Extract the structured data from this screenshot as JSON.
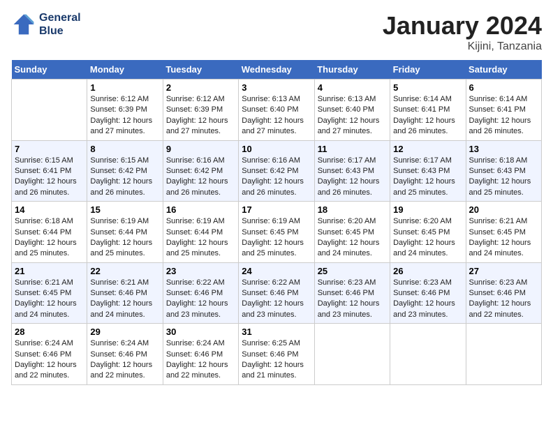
{
  "header": {
    "logo_line1": "General",
    "logo_line2": "Blue",
    "title": "January 2024",
    "subtitle": "Kijini, Tanzania"
  },
  "days_of_week": [
    "Sunday",
    "Monday",
    "Tuesday",
    "Wednesday",
    "Thursday",
    "Friday",
    "Saturday"
  ],
  "weeks": [
    [
      {
        "day": "",
        "sunrise": "",
        "sunset": "",
        "daylight": ""
      },
      {
        "day": "1",
        "sunrise": "Sunrise: 6:12 AM",
        "sunset": "Sunset: 6:39 PM",
        "daylight": "Daylight: 12 hours and 27 minutes."
      },
      {
        "day": "2",
        "sunrise": "Sunrise: 6:12 AM",
        "sunset": "Sunset: 6:39 PM",
        "daylight": "Daylight: 12 hours and 27 minutes."
      },
      {
        "day": "3",
        "sunrise": "Sunrise: 6:13 AM",
        "sunset": "Sunset: 6:40 PM",
        "daylight": "Daylight: 12 hours and 27 minutes."
      },
      {
        "day": "4",
        "sunrise": "Sunrise: 6:13 AM",
        "sunset": "Sunset: 6:40 PM",
        "daylight": "Daylight: 12 hours and 27 minutes."
      },
      {
        "day": "5",
        "sunrise": "Sunrise: 6:14 AM",
        "sunset": "Sunset: 6:41 PM",
        "daylight": "Daylight: 12 hours and 26 minutes."
      },
      {
        "day": "6",
        "sunrise": "Sunrise: 6:14 AM",
        "sunset": "Sunset: 6:41 PM",
        "daylight": "Daylight: 12 hours and 26 minutes."
      }
    ],
    [
      {
        "day": "7",
        "sunrise": "Sunrise: 6:15 AM",
        "sunset": "Sunset: 6:41 PM",
        "daylight": "Daylight: 12 hours and 26 minutes."
      },
      {
        "day": "8",
        "sunrise": "Sunrise: 6:15 AM",
        "sunset": "Sunset: 6:42 PM",
        "daylight": "Daylight: 12 hours and 26 minutes."
      },
      {
        "day": "9",
        "sunrise": "Sunrise: 6:16 AM",
        "sunset": "Sunset: 6:42 PM",
        "daylight": "Daylight: 12 hours and 26 minutes."
      },
      {
        "day": "10",
        "sunrise": "Sunrise: 6:16 AM",
        "sunset": "Sunset: 6:42 PM",
        "daylight": "Daylight: 12 hours and 26 minutes."
      },
      {
        "day": "11",
        "sunrise": "Sunrise: 6:17 AM",
        "sunset": "Sunset: 6:43 PM",
        "daylight": "Daylight: 12 hours and 26 minutes."
      },
      {
        "day": "12",
        "sunrise": "Sunrise: 6:17 AM",
        "sunset": "Sunset: 6:43 PM",
        "daylight": "Daylight: 12 hours and 25 minutes."
      },
      {
        "day": "13",
        "sunrise": "Sunrise: 6:18 AM",
        "sunset": "Sunset: 6:43 PM",
        "daylight": "Daylight: 12 hours and 25 minutes."
      }
    ],
    [
      {
        "day": "14",
        "sunrise": "Sunrise: 6:18 AM",
        "sunset": "Sunset: 6:44 PM",
        "daylight": "Daylight: 12 hours and 25 minutes."
      },
      {
        "day": "15",
        "sunrise": "Sunrise: 6:19 AM",
        "sunset": "Sunset: 6:44 PM",
        "daylight": "Daylight: 12 hours and 25 minutes."
      },
      {
        "day": "16",
        "sunrise": "Sunrise: 6:19 AM",
        "sunset": "Sunset: 6:44 PM",
        "daylight": "Daylight: 12 hours and 25 minutes."
      },
      {
        "day": "17",
        "sunrise": "Sunrise: 6:19 AM",
        "sunset": "Sunset: 6:45 PM",
        "daylight": "Daylight: 12 hours and 25 minutes."
      },
      {
        "day": "18",
        "sunrise": "Sunrise: 6:20 AM",
        "sunset": "Sunset: 6:45 PM",
        "daylight": "Daylight: 12 hours and 24 minutes."
      },
      {
        "day": "19",
        "sunrise": "Sunrise: 6:20 AM",
        "sunset": "Sunset: 6:45 PM",
        "daylight": "Daylight: 12 hours and 24 minutes."
      },
      {
        "day": "20",
        "sunrise": "Sunrise: 6:21 AM",
        "sunset": "Sunset: 6:45 PM",
        "daylight": "Daylight: 12 hours and 24 minutes."
      }
    ],
    [
      {
        "day": "21",
        "sunrise": "Sunrise: 6:21 AM",
        "sunset": "Sunset: 6:45 PM",
        "daylight": "Daylight: 12 hours and 24 minutes."
      },
      {
        "day": "22",
        "sunrise": "Sunrise: 6:21 AM",
        "sunset": "Sunset: 6:46 PM",
        "daylight": "Daylight: 12 hours and 24 minutes."
      },
      {
        "day": "23",
        "sunrise": "Sunrise: 6:22 AM",
        "sunset": "Sunset: 6:46 PM",
        "daylight": "Daylight: 12 hours and 23 minutes."
      },
      {
        "day": "24",
        "sunrise": "Sunrise: 6:22 AM",
        "sunset": "Sunset: 6:46 PM",
        "daylight": "Daylight: 12 hours and 23 minutes."
      },
      {
        "day": "25",
        "sunrise": "Sunrise: 6:23 AM",
        "sunset": "Sunset: 6:46 PM",
        "daylight": "Daylight: 12 hours and 23 minutes."
      },
      {
        "day": "26",
        "sunrise": "Sunrise: 6:23 AM",
        "sunset": "Sunset: 6:46 PM",
        "daylight": "Daylight: 12 hours and 23 minutes."
      },
      {
        "day": "27",
        "sunrise": "Sunrise: 6:23 AM",
        "sunset": "Sunset: 6:46 PM",
        "daylight": "Daylight: 12 hours and 22 minutes."
      }
    ],
    [
      {
        "day": "28",
        "sunrise": "Sunrise: 6:24 AM",
        "sunset": "Sunset: 6:46 PM",
        "daylight": "Daylight: 12 hours and 22 minutes."
      },
      {
        "day": "29",
        "sunrise": "Sunrise: 6:24 AM",
        "sunset": "Sunset: 6:46 PM",
        "daylight": "Daylight: 12 hours and 22 minutes."
      },
      {
        "day": "30",
        "sunrise": "Sunrise: 6:24 AM",
        "sunset": "Sunset: 6:46 PM",
        "daylight": "Daylight: 12 hours and 22 minutes."
      },
      {
        "day": "31",
        "sunrise": "Sunrise: 6:25 AM",
        "sunset": "Sunset: 6:46 PM",
        "daylight": "Daylight: 12 hours and 21 minutes."
      },
      {
        "day": "",
        "sunrise": "",
        "sunset": "",
        "daylight": ""
      },
      {
        "day": "",
        "sunrise": "",
        "sunset": "",
        "daylight": ""
      },
      {
        "day": "",
        "sunrise": "",
        "sunset": "",
        "daylight": ""
      }
    ]
  ]
}
